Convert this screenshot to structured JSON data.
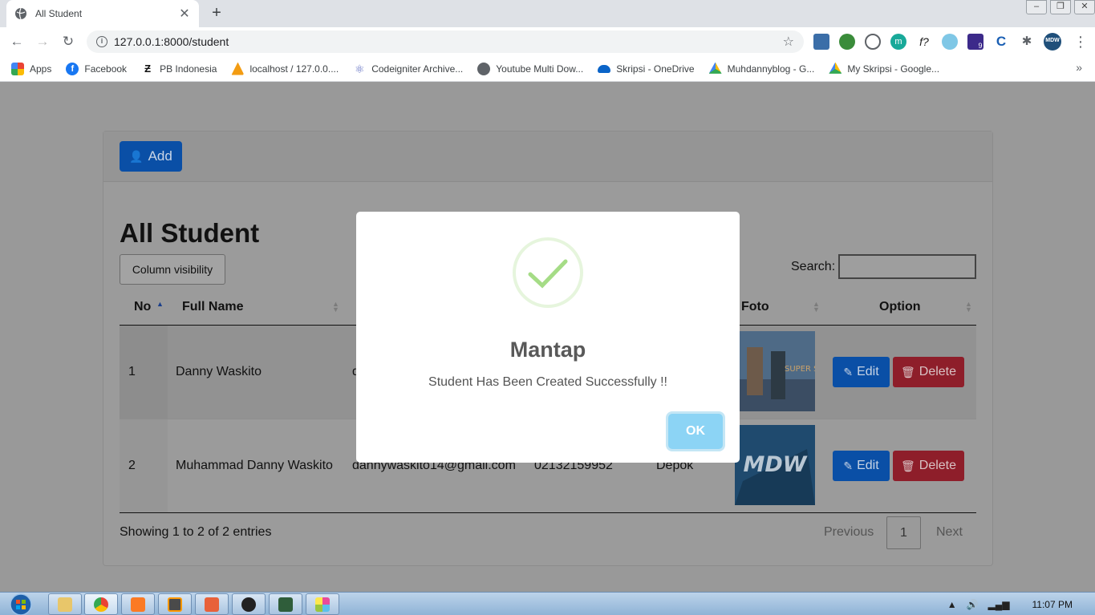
{
  "browser": {
    "tab_title": "All Student",
    "url": "127.0.0.1:8000/student",
    "bookmarks": [
      {
        "label": "Apps",
        "icon": "apps-grid-icon"
      },
      {
        "label": "Facebook",
        "icon": "facebook-icon"
      },
      {
        "label": "PB Indonesia",
        "icon": "pb-icon"
      },
      {
        "label": "localhost / 127.0.0....",
        "icon": "phpmyadmin-icon"
      },
      {
        "label": "Codeigniter Archive...",
        "icon": "atom-icon"
      },
      {
        "label": "Youtube Multi Dow...",
        "icon": "globe-icon"
      },
      {
        "label": "Skripsi - OneDrive",
        "icon": "onedrive-icon"
      },
      {
        "label": "Muhdannyblog - G...",
        "icon": "drive-icon"
      },
      {
        "label": "My Skripsi - Google...",
        "icon": "drive-icon"
      }
    ],
    "more_bookmarks": "»",
    "extension_badge": "9",
    "profile": "MDW"
  },
  "page": {
    "add_label": "Add",
    "title": "All Student",
    "column_visibility_label": "Column visibility",
    "search_label": "Search:",
    "columns": [
      "No",
      "Full Name",
      "Foto",
      "Option"
    ],
    "rows": [
      {
        "no": "1",
        "name": "Danny Waskito",
        "email": "d",
        "phone": "",
        "city": ""
      },
      {
        "no": "2",
        "name": "Muhammad Danny Waskito",
        "email": "dannywaskito14@gmail.com",
        "phone": "02132159952",
        "city": "Depok"
      }
    ],
    "edit_label": "Edit",
    "delete_label": "Delete",
    "info": "Showing 1 to 2 of 2 entries",
    "pagination": {
      "previous": "Previous",
      "current": "1",
      "next": "Next"
    },
    "photo2_text": "MDW",
    "photo1_text": "SUPER SHOW"
  },
  "modal": {
    "title": "Mantap",
    "message": "Student Has Been Created Successfully !!",
    "ok_label": "OK"
  },
  "taskbar": {
    "clock": "11:07 PM"
  },
  "colors": {
    "primary": "#0a4fa6",
    "danger": "#8e1e2a",
    "success": "#a5dc86",
    "ok_button": "#8cd4f5"
  }
}
